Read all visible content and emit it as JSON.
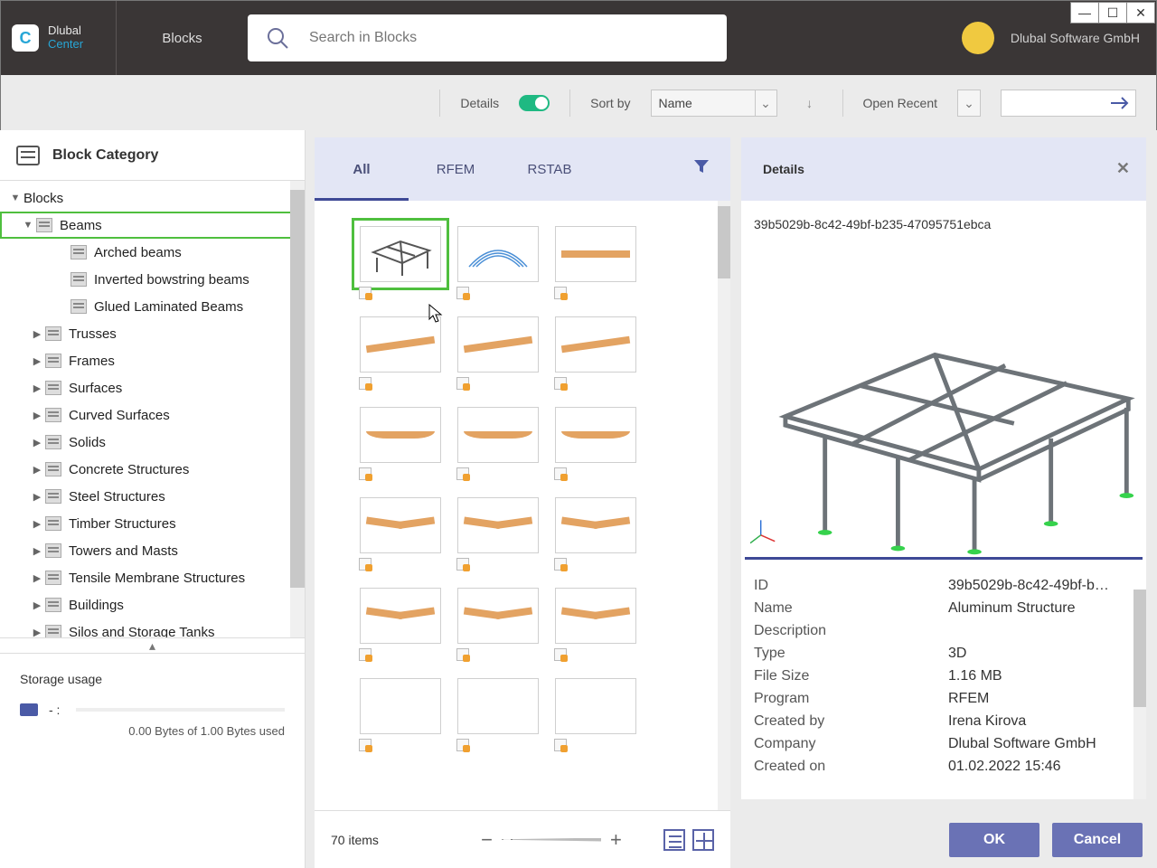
{
  "header": {
    "brand": "Dlubal",
    "brand_sub": "Center",
    "blocks_label": "Blocks",
    "search_placeholder": "Search in Blocks",
    "company": "Dlubal Software GmbH"
  },
  "toolbar": {
    "details_label": "Details",
    "sort_label": "Sort by",
    "sort_value": "Name",
    "open_recent_label": "Open Recent"
  },
  "sidebar": {
    "title": "Block Category",
    "root": "Blocks",
    "selected": "Beams",
    "children": [
      "Arched beams",
      "Inverted bowstring beams",
      "Glued Laminated Beams"
    ],
    "others": [
      "Trusses",
      "Frames",
      "Surfaces",
      "Curved Surfaces",
      "Solids",
      "Concrete Structures",
      "Steel Structures",
      "Timber Structures",
      "Towers and Masts",
      "Tensile Membrane Structures",
      "Buildings",
      "Silos and Storage Tanks"
    ]
  },
  "storage": {
    "title": "Storage usage",
    "dash": "-  :",
    "line": "0.00 Bytes of 1.00 Bytes used"
  },
  "gallery": {
    "tabs": [
      "All",
      "RFEM",
      "RSTAB"
    ],
    "count": "70 items",
    "rows": [
      [
        "3d",
        "arch",
        "flat"
      ],
      [
        "slope",
        "slope",
        "slope"
      ],
      [
        "bow",
        "bow",
        "bow"
      ],
      [
        "gable",
        "gable",
        "gable"
      ],
      [
        "gable",
        "gable",
        "gable"
      ],
      [
        "",
        "",
        ""
      ]
    ]
  },
  "details": {
    "title": "Details",
    "uuid": "39b5029b-8c42-49bf-b235-47095751ebca",
    "props": [
      [
        "ID",
        "39b5029b-8c42-49bf-b…"
      ],
      [
        "Name",
        "Aluminum Structure"
      ],
      [
        "Description",
        ""
      ],
      [
        "Type",
        "3D"
      ],
      [
        "File Size",
        "1.16 MB"
      ],
      [
        "Program",
        "RFEM"
      ],
      [
        "Created by",
        "Irena Kirova"
      ],
      [
        "Company",
        "Dlubal Software GmbH"
      ],
      [
        "Created on",
        "01.02.2022 15:46"
      ]
    ]
  },
  "footer": {
    "ok": "OK",
    "cancel": "Cancel"
  }
}
